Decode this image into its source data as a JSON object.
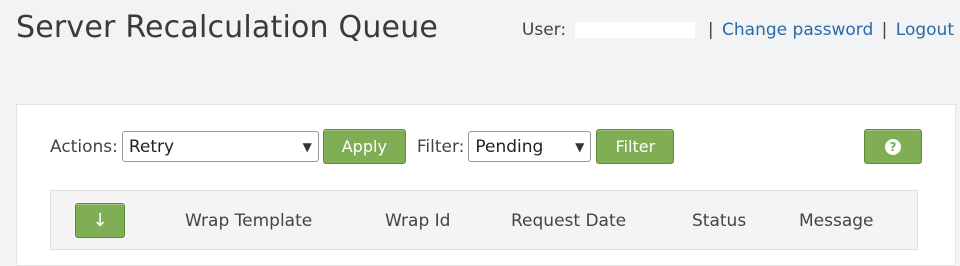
{
  "header": {
    "title": "Server Recalculation Queue",
    "user_label": "User:",
    "change_password": "Change password",
    "separator": "|",
    "logout": "Logout"
  },
  "toolbar": {
    "actions_label": "Actions:",
    "actions_value": "Retry",
    "apply_label": "Apply",
    "filter_label": "Filter:",
    "filter_value": "Pending",
    "filter_button": "Filter",
    "help_symbol": "?"
  },
  "table": {
    "sort_symbol": "↓",
    "columns": [
      "Wrap Template",
      "Wrap Id",
      "Request Date",
      "Status",
      "Message"
    ]
  },
  "colors": {
    "button_green": "#7fae55",
    "link_blue": "#2a6aa8",
    "background": "#f2f3f5"
  },
  "icons": {
    "dropdown": "chevron-down-icon",
    "help": "help-icon",
    "sort": "sort-down-arrow-icon"
  }
}
